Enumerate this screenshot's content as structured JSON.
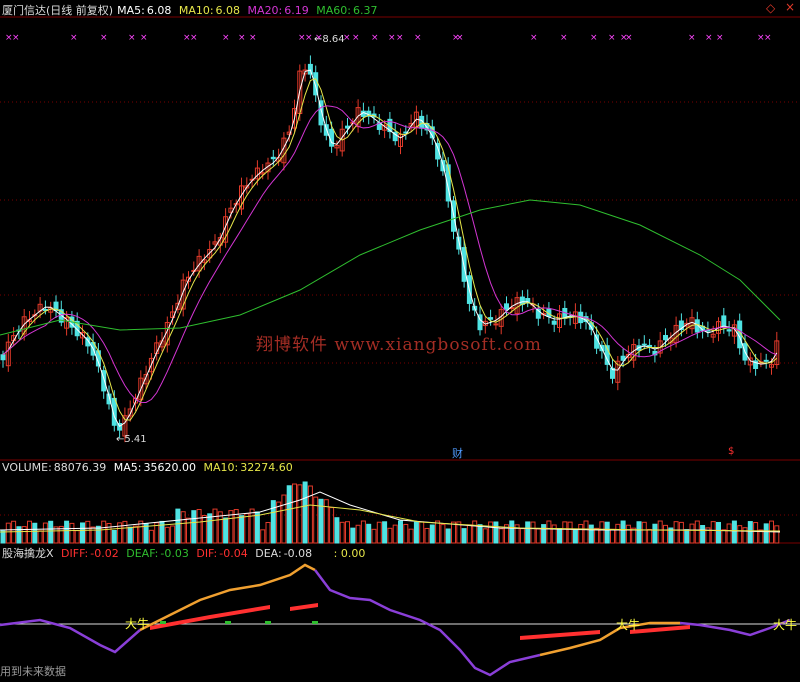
{
  "colors": {
    "bg": "#000000",
    "grid": "#7a0000",
    "up": "#e23a2a",
    "down": "#4fe3e3",
    "ma5": "#ffffff",
    "ma10": "#e6e64a",
    "ma20": "#d335d3",
    "ma60": "#2fbe2f",
    "diff_pos": "#ff3030",
    "deaf": "#2fbe2f",
    "osc_orange": "#f0a030",
    "osc_purple": "#8a3fd8",
    "magenta": "#ff45ff"
  },
  "price_panel": {
    "title": "厦门信达(日线 前复权)",
    "ma5": {
      "label": "MA5:",
      "value": "6.08"
    },
    "ma10": {
      "label": "MA10:",
      "value": "6.08"
    },
    "ma20": {
      "label": "MA20:",
      "value": "6.19"
    },
    "ma60": {
      "label": "MA60:",
      "value": "6.37"
    },
    "high_label": "8.64",
    "low_label": "5.41",
    "event_marker": "财",
    "event_marker2": "$",
    "corner_icons": [
      "diamond-icon",
      "close-icon"
    ],
    "corner_symbols": [
      "◇",
      "×"
    ],
    "watermark": "翔博软件 www.xiangbosoft.com"
  },
  "volume_panel": {
    "title": "VOLUME:",
    "value": "88076.39",
    "ma5": {
      "label": "MA5:",
      "value": "35620.00"
    },
    "ma10": {
      "label": "MA10:",
      "value": "32274.60"
    }
  },
  "indicator_panel": {
    "title": "股海擒龙X",
    "diff": {
      "label": "DIFF:",
      "value": "-0.02"
    },
    "deaf": {
      "label": "DEAF:",
      "value": "-0.03"
    },
    "dif": {
      "label": "DIF:",
      "value": "-0.04"
    },
    "dea": {
      "label": "DEA:",
      "value": "-0.08"
    },
    "extra": ": 0.00",
    "signals": [
      "大牛",
      "大牛",
      "大牛"
    ]
  },
  "footer": "用到未来数据"
}
